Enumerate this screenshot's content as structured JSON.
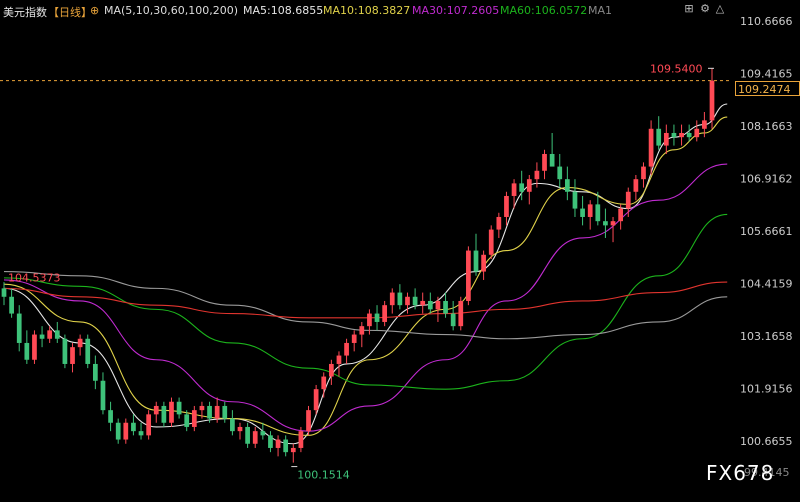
{
  "header": {
    "symbol": "美元指数",
    "period": "【日线】",
    "ma_params": "MA(5,10,30,60,100,200)",
    "ma5": "MA5:108.6855",
    "ma10": "MA10:108.3827",
    "ma30": "MA30:107.2605",
    "ma60": "MA60:106.0572",
    "ma1": "MA1"
  },
  "watermark": "FX678",
  "current_price_label": "109.2474",
  "colors": {
    "up": "#ff4a55",
    "down": "#3ec27a",
    "ma5": "#e6e6e6",
    "ma10": "#e0d24a",
    "ma30": "#c02bd0",
    "ma60": "#1cb31c",
    "ma100": "#9a9a9a",
    "ma200": "#e0342e",
    "ref_line": "#e8a33a",
    "axis_text": "#cccccc"
  },
  "chart_data": {
    "type": "candlestick",
    "title": "美元指数 日线",
    "y_ticks": [
      "110.6666",
      "109.4165",
      "108.1663",
      "106.9162",
      "105.6661",
      "104.4159",
      "103.1658",
      "101.9156",
      "100.6655"
    ],
    "ylim": [
      100.0,
      111.0
    ],
    "annotations": {
      "high_label": "109.5400",
      "low_label": "100.1514",
      "left_label": "104.5373",
      "bottom_right_label": "99.4145"
    },
    "reference_price": 109.2474,
    "candles": [
      [
        104.3,
        104.45,
        103.9,
        104.1
      ],
      [
        104.1,
        104.3,
        103.6,
        103.7
      ],
      [
        103.7,
        103.9,
        102.8,
        103.0
      ],
      [
        103.0,
        103.3,
        102.5,
        102.6
      ],
      [
        102.6,
        103.3,
        102.5,
        103.2
      ],
      [
        103.2,
        103.4,
        102.9,
        103.1
      ],
      [
        103.1,
        103.4,
        103.0,
        103.3
      ],
      [
        103.3,
        103.5,
        103.0,
        103.1
      ],
      [
        103.1,
        103.2,
        102.4,
        102.5
      ],
      [
        102.5,
        103.0,
        102.3,
        102.9
      ],
      [
        102.9,
        103.2,
        102.7,
        103.1
      ],
      [
        103.1,
        103.2,
        102.4,
        102.5
      ],
      [
        102.5,
        102.7,
        101.9,
        102.1
      ],
      [
        102.1,
        102.3,
        101.3,
        101.4
      ],
      [
        101.4,
        101.6,
        100.9,
        101.1
      ],
      [
        101.1,
        101.2,
        100.6,
        100.7
      ],
      [
        100.7,
        101.2,
        100.6,
        101.1
      ],
      [
        101.1,
        101.3,
        100.8,
        100.9
      ],
      [
        100.9,
        101.1,
        100.7,
        100.8
      ],
      [
        100.8,
        101.4,
        100.7,
        101.3
      ],
      [
        101.3,
        101.6,
        101.1,
        101.5
      ],
      [
        101.5,
        101.6,
        101.0,
        101.1
      ],
      [
        101.1,
        101.7,
        101.0,
        101.6
      ],
      [
        101.6,
        101.7,
        101.2,
        101.3
      ],
      [
        101.3,
        101.4,
        100.9,
        101.0
      ],
      [
        101.0,
        101.5,
        100.9,
        101.4
      ],
      [
        101.4,
        101.6,
        101.2,
        101.5
      ],
      [
        101.5,
        101.6,
        101.1,
        101.2
      ],
      [
        101.2,
        101.7,
        101.1,
        101.5
      ],
      [
        101.5,
        101.6,
        101.1,
        101.2
      ],
      [
        101.2,
        101.4,
        100.8,
        100.9
      ],
      [
        100.9,
        101.1,
        100.7,
        101.0
      ],
      [
        101.0,
        101.1,
        100.5,
        100.6
      ],
      [
        100.6,
        101.0,
        100.5,
        100.9
      ],
      [
        100.9,
        101.1,
        100.7,
        100.8
      ],
      [
        100.8,
        100.9,
        100.4,
        100.5
      ],
      [
        100.5,
        100.8,
        100.3,
        100.7
      ],
      [
        100.7,
        100.8,
        100.3,
        100.4
      ],
      [
        100.4,
        100.6,
        100.15,
        100.5
      ],
      [
        100.5,
        101.0,
        100.4,
        100.9
      ],
      [
        100.9,
        101.5,
        100.8,
        101.4
      ],
      [
        101.4,
        102.0,
        101.3,
        101.9
      ],
      [
        101.9,
        102.3,
        101.7,
        102.2
      ],
      [
        102.2,
        102.6,
        102.0,
        102.5
      ],
      [
        102.5,
        102.8,
        102.2,
        102.7
      ],
      [
        102.7,
        103.1,
        102.5,
        103.0
      ],
      [
        103.0,
        103.3,
        102.8,
        103.2
      ],
      [
        103.2,
        103.5,
        102.9,
        103.4
      ],
      [
        103.4,
        103.8,
        103.2,
        103.7
      ],
      [
        103.7,
        103.9,
        103.3,
        103.5
      ],
      [
        103.5,
        104.0,
        103.4,
        103.9
      ],
      [
        103.9,
        104.3,
        103.7,
        104.2
      ],
      [
        104.2,
        104.4,
        103.8,
        103.9
      ],
      [
        103.9,
        104.2,
        103.7,
        104.1
      ],
      [
        104.1,
        104.3,
        103.8,
        103.9
      ],
      [
        103.9,
        104.2,
        103.7,
        104.0
      ],
      [
        104.0,
        104.2,
        103.7,
        103.8
      ],
      [
        103.8,
        104.1,
        103.5,
        104.0
      ],
      [
        104.0,
        104.2,
        103.6,
        103.7
      ],
      [
        103.7,
        104.0,
        103.3,
        103.4
      ],
      [
        103.4,
        104.1,
        103.3,
        104.0
      ],
      [
        104.0,
        105.3,
        103.9,
        105.2
      ],
      [
        105.2,
        105.6,
        104.6,
        104.7
      ],
      [
        104.7,
        105.2,
        104.5,
        105.1
      ],
      [
        105.1,
        105.8,
        105.0,
        105.7
      ],
      [
        105.7,
        106.1,
        105.5,
        106.0
      ],
      [
        106.0,
        106.6,
        105.8,
        106.5
      ],
      [
        106.5,
        106.9,
        106.2,
        106.8
      ],
      [
        106.8,
        107.1,
        106.4,
        106.6
      ],
      [
        106.6,
        107.0,
        106.3,
        106.9
      ],
      [
        106.9,
        107.3,
        106.7,
        107.1
      ],
      [
        107.1,
        107.6,
        106.9,
        107.5
      ],
      [
        107.5,
        108.0,
        107.3,
        107.2
      ],
      [
        107.2,
        107.5,
        106.7,
        106.9
      ],
      [
        106.9,
        107.2,
        106.4,
        106.6
      ],
      [
        106.6,
        106.9,
        106.0,
        106.2
      ],
      [
        106.2,
        106.5,
        105.8,
        106.0
      ],
      [
        106.0,
        106.4,
        105.7,
        106.3
      ],
      [
        106.3,
        106.6,
        105.8,
        105.9
      ],
      [
        105.9,
        106.2,
        105.5,
        105.8
      ],
      [
        105.8,
        106.0,
        105.4,
        105.9
      ],
      [
        105.9,
        106.3,
        105.7,
        106.2
      ],
      [
        106.2,
        106.7,
        106.0,
        106.6
      ],
      [
        106.6,
        107.0,
        106.4,
        106.9
      ],
      [
        106.9,
        107.3,
        106.7,
        107.2
      ],
      [
        107.2,
        108.3,
        107.0,
        108.1
      ],
      [
        108.1,
        108.4,
        107.6,
        107.7
      ],
      [
        107.7,
        108.2,
        107.5,
        108.0
      ],
      [
        108.0,
        108.2,
        107.7,
        107.9
      ],
      [
        107.9,
        108.2,
        107.7,
        108.0
      ],
      [
        108.0,
        108.2,
        107.8,
        107.9
      ],
      [
        107.9,
        108.3,
        107.8,
        108.1
      ],
      [
        108.1,
        108.5,
        107.9,
        108.3
      ],
      [
        108.3,
        109.54,
        108.1,
        109.2474
      ]
    ],
    "ma_lines": [
      {
        "name": "MA5",
        "points": [
          [
            0,
            104.3
          ],
          [
            10,
            103.0
          ],
          [
            20,
            101.0
          ],
          [
            30,
            101.2
          ],
          [
            38,
            100.6
          ],
          [
            45,
            102.5
          ],
          [
            55,
            103.9
          ],
          [
            62,
            104.7
          ],
          [
            70,
            106.8
          ],
          [
            76,
            106.6
          ],
          [
            82,
            106.2
          ],
          [
            88,
            107.9
          ],
          [
            92,
            108.2
          ],
          [
            95,
            108.69
          ]
        ]
      },
      {
        "name": "MA10",
        "points": [
          [
            0,
            104.4
          ],
          [
            10,
            103.5
          ],
          [
            20,
            101.4
          ],
          [
            30,
            101.2
          ],
          [
            40,
            100.8
          ],
          [
            48,
            102.6
          ],
          [
            58,
            103.8
          ],
          [
            66,
            105.2
          ],
          [
            74,
            106.7
          ],
          [
            82,
            106.3
          ],
          [
            88,
            107.6
          ],
          [
            92,
            108.0
          ],
          [
            95,
            108.38
          ]
        ]
      },
      {
        "name": "MA30",
        "points": [
          [
            0,
            104.5
          ],
          [
            10,
            104.0
          ],
          [
            20,
            102.6
          ],
          [
            30,
            101.6
          ],
          [
            40,
            100.9
          ],
          [
            48,
            101.5
          ],
          [
            58,
            102.6
          ],
          [
            66,
            104.0
          ],
          [
            76,
            105.5
          ],
          [
            86,
            106.4
          ],
          [
            95,
            107.26
          ]
        ]
      },
      {
        "name": "MA60",
        "points": [
          [
            0,
            104.55
          ],
          [
            10,
            104.35
          ],
          [
            20,
            103.8
          ],
          [
            30,
            103.0
          ],
          [
            40,
            102.4
          ],
          [
            48,
            102.0
          ],
          [
            58,
            101.9
          ],
          [
            66,
            102.1
          ],
          [
            76,
            103.1
          ],
          [
            86,
            104.6
          ],
          [
            95,
            106.06
          ]
        ]
      },
      {
        "name": "MA100",
        "points": [
          [
            0,
            104.7
          ],
          [
            10,
            104.6
          ],
          [
            20,
            104.3
          ],
          [
            30,
            103.9
          ],
          [
            40,
            103.5
          ],
          [
            48,
            103.3
          ],
          [
            58,
            103.2
          ],
          [
            66,
            103.1
          ],
          [
            76,
            103.2
          ],
          [
            86,
            103.5
          ],
          [
            95,
            104.1
          ]
        ]
      },
      {
        "name": "MA200",
        "points": [
          [
            0,
            104.3
          ],
          [
            10,
            104.1
          ],
          [
            20,
            103.9
          ],
          [
            30,
            103.7
          ],
          [
            40,
            103.6
          ],
          [
            48,
            103.6
          ],
          [
            58,
            103.7
          ],
          [
            66,
            103.8
          ],
          [
            76,
            104.0
          ],
          [
            86,
            104.2
          ],
          [
            95,
            104.45
          ]
        ]
      }
    ]
  }
}
